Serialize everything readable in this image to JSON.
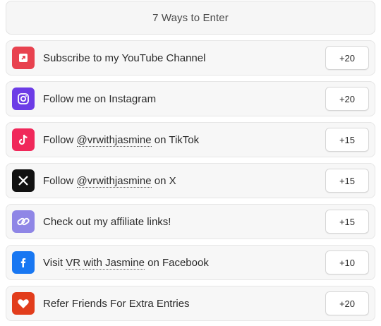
{
  "header": {
    "title": "7 Ways to Enter"
  },
  "entries": [
    {
      "icon": "youtube-icon",
      "color": "#e8424f",
      "pre": "Subscribe to my YouTube Channel",
      "handle": "",
      "post": "",
      "points": "+20"
    },
    {
      "icon": "instagram-icon",
      "color": "#6c3ce6",
      "pre": "Follow me on Instagram",
      "handle": "",
      "post": "",
      "points": "+20"
    },
    {
      "icon": "tiktok-icon",
      "color": "#f0285a",
      "pre": "Follow ",
      "handle": "@vrwithjasmine",
      "post": " on TikTok",
      "points": "+15"
    },
    {
      "icon": "x-icon",
      "color": "#111111",
      "pre": "Follow ",
      "handle": "@vrwithjasmine",
      "post": " on X",
      "points": "+15"
    },
    {
      "icon": "link-icon",
      "color": "#8f86e6",
      "pre": "Check out my affiliate links!",
      "handle": "",
      "post": "",
      "points": "+15"
    },
    {
      "icon": "facebook-icon",
      "color": "#1877f2",
      "pre": "Visit ",
      "handle": "VR with Jasmine",
      "post": " on Facebook",
      "points": "+10"
    },
    {
      "icon": "heart-icon",
      "color": "#e23d1c",
      "pre": "Refer Friends For Extra Entries",
      "handle": "",
      "post": "",
      "points": "+20"
    }
  ]
}
